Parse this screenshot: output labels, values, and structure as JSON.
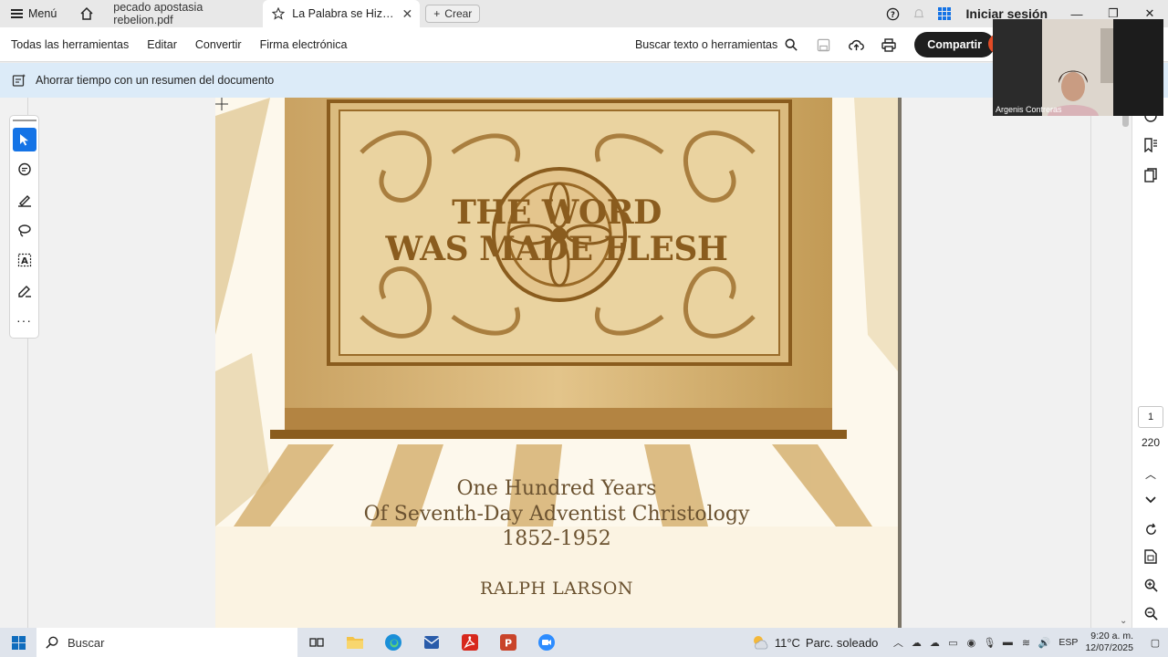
{
  "tabbar": {
    "menu_label": "Menú",
    "tabs": [
      {
        "title": "pecado apostasia rebelion.pdf"
      },
      {
        "title": "La Palabra se Hizo C..."
      }
    ],
    "create_label": "Crear",
    "signin_label": "Iniciar sesión"
  },
  "toolbar": {
    "items": [
      "Todas las herramientas",
      "Editar",
      "Convertir",
      "Firma electrónica"
    ],
    "search_label": "Buscar texto o herramientas",
    "share_label": "Compartir"
  },
  "banner": {
    "text": "Ahorrar tiempo con un resumen del documento"
  },
  "document": {
    "title_line1": "THE WORD",
    "title_line2": "WAS MADE FLESH",
    "subtitle_line1": "One Hundred Years",
    "subtitle_line2": "Of Seventh-Day Adventist Christology",
    "subtitle_line3": "1852-1952",
    "author": "RALPH LARSON"
  },
  "navigation": {
    "current_page": "1",
    "total_pages": "220"
  },
  "webcam": {
    "participant_name": "Argenis Contreras"
  },
  "taskbar": {
    "search_placeholder": "Buscar",
    "weather_temp": "11°C",
    "weather_desc": "Parc. soleado",
    "language": "ESP",
    "time": "9:20 a. m.",
    "date": "12/07/2025"
  },
  "colors": {
    "accent": "#1473e6",
    "share_button": "#1f1f1f",
    "banner_bg": "#dcebf8",
    "cover_ink": "#8a5c1e"
  }
}
